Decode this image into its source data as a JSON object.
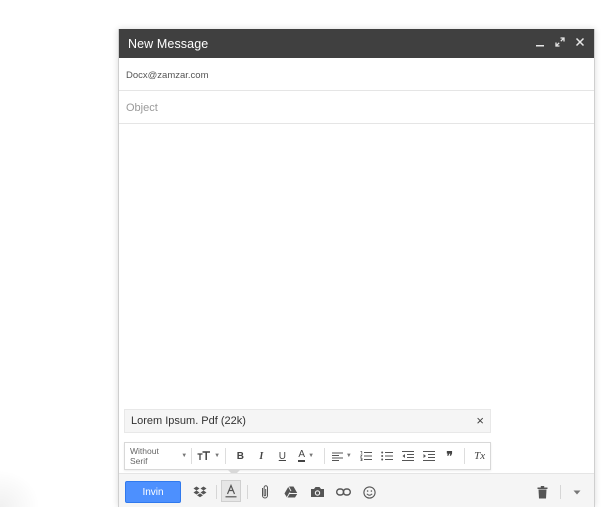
{
  "window": {
    "title": "New Message",
    "controls": [
      {
        "name": "minimize-icon",
        "glyph": "minimize"
      },
      {
        "name": "expand-icon",
        "glyph": "expand"
      },
      {
        "name": "close-icon",
        "glyph": "close"
      }
    ]
  },
  "recipients": {
    "to_value": "Docx@zamzar.com"
  },
  "subject": {
    "placeholder": "Object"
  },
  "attachment": {
    "name": "Lorem Ipsum. Pdf (22k)",
    "close_glyph": "×"
  },
  "format_bar": {
    "font_label": "Without Serif",
    "bold_label": "B",
    "italic_label": "I",
    "underline_label": "U",
    "text_color_label": "A",
    "quote_label": "❞",
    "clear_label": "Tx"
  },
  "bottom_bar": {
    "send_label": "Invin",
    "icons": [
      "dropbox-icon",
      "formatting-icon",
      "attach-icon",
      "drive-icon",
      "camera-icon",
      "link-icon",
      "emoji-icon",
      "trash-icon",
      "more-options-icon"
    ]
  },
  "colors": {
    "titlebar": "#404040",
    "send_button": "#4d90fe"
  }
}
